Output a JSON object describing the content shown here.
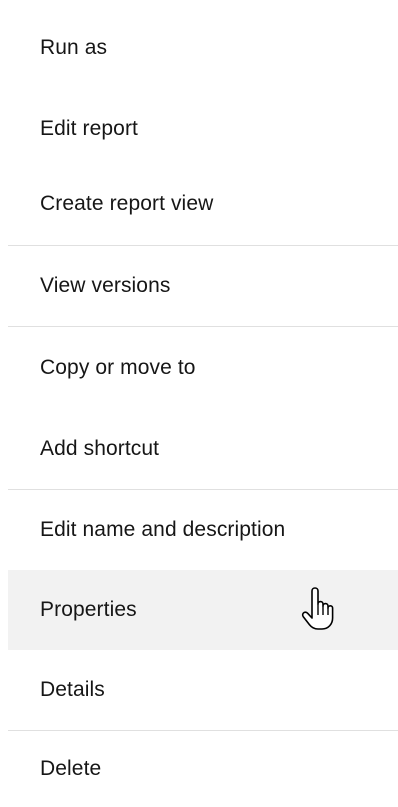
{
  "menu": {
    "groups": [
      {
        "items": [
          {
            "label": "Run as"
          },
          {
            "label": "Edit report"
          },
          {
            "label": "Create report view"
          }
        ]
      },
      {
        "items": [
          {
            "label": "View versions"
          }
        ]
      },
      {
        "items": [
          {
            "label": "Copy or move to"
          },
          {
            "label": "Add shortcut"
          }
        ]
      },
      {
        "items": [
          {
            "label": "Edit name and description"
          },
          {
            "label": "Properties",
            "hovered": true
          },
          {
            "label": "Details"
          }
        ]
      },
      {
        "items": [
          {
            "label": "Delete"
          }
        ]
      }
    ]
  },
  "colors": {
    "text": "#161616",
    "hover_background": "#f2f2f2",
    "divider": "#e0e0e0",
    "background": "#ffffff"
  },
  "cursor": {
    "icon": "hand-pointer-icon"
  }
}
